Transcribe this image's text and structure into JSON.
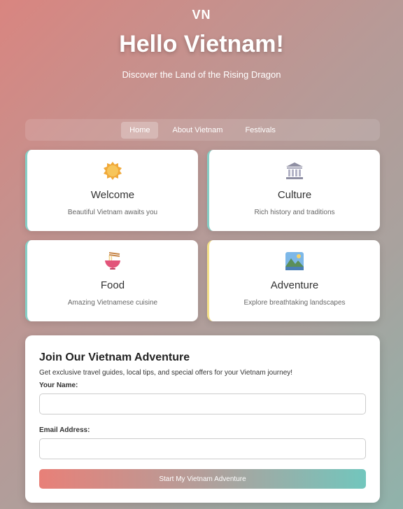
{
  "header": {
    "logo": "VN",
    "title": "Hello Vietnam!",
    "subtitle": "Discover the Land of the Rising Dragon"
  },
  "nav": {
    "items": [
      {
        "label": "Home",
        "active": true
      },
      {
        "label": "About Vietnam",
        "active": false
      },
      {
        "label": "Festivals",
        "active": false
      }
    ]
  },
  "cards": [
    {
      "title": "Welcome",
      "description": "Beautiful Vietnam awaits you",
      "icon": "sun-icon",
      "accent": "#86cfc6"
    },
    {
      "title": "Culture",
      "description": "Rich history and traditions",
      "icon": "classical-building-icon",
      "accent": "#86cfc6"
    },
    {
      "title": "Food",
      "description": "Amazing Vietnamese cuisine",
      "icon": "noodle-bowl-icon",
      "accent": "#86cfc6"
    },
    {
      "title": "Adventure",
      "description": "Explore breathtaking landscapes",
      "icon": "landscape-icon",
      "accent": "#f4e08a"
    }
  ],
  "signup": {
    "title": "Join Our Vietnam Adventure",
    "description": "Get exclusive travel guides, local tips, and special offers for your Vietnam journey!",
    "name_label": "Your Name:",
    "name_value": "",
    "email_label": "Email Address:",
    "email_value": "",
    "submit_label": "Start My Vietnam Adventure"
  },
  "colors": {
    "accent_teal": "#72c6bd",
    "accent_coral": "#e88078"
  }
}
